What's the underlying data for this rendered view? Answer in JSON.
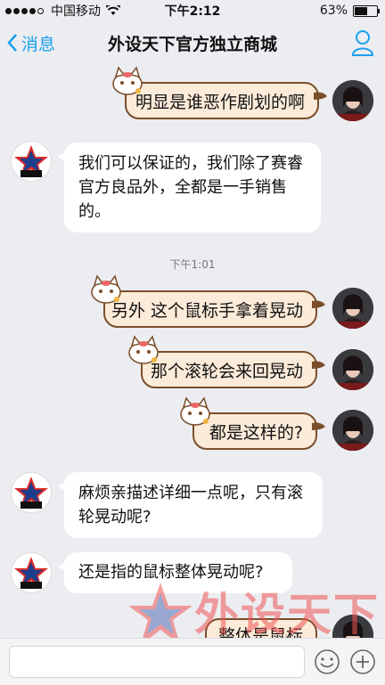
{
  "status": {
    "carrier": "中国移动",
    "time": "下午2:12",
    "battery": "63%",
    "battery_level": 0.63
  },
  "nav": {
    "back_label": "消息",
    "title": "外设天下官方独立商城"
  },
  "messages": [
    {
      "from": "user",
      "text": "明显是谁恶作剧划的啊"
    },
    {
      "from": "shop",
      "text": "我们可以保证的，我们除了赛睿官方良品外，全都是一手销售的。"
    },
    {
      "from": "user",
      "text": "另外 这个鼠标手拿着晃动"
    },
    {
      "from": "user",
      "text": "那个滚轮会来回晃动"
    },
    {
      "from": "user",
      "text": "都是这样的?"
    },
    {
      "from": "shop",
      "text": "麻烦亲描述详细一点呢，只有滚轮晃动呢?"
    },
    {
      "from": "shop",
      "text": "还是指的鼠标整体晃动呢?"
    },
    {
      "from": "user",
      "text": "整体是鼠标"
    }
  ],
  "timestamp": "下午1:01",
  "watermark": {
    "text": "外设天下",
    "url": "www.wstx.com"
  },
  "colors": {
    "accent": "#19a0ec",
    "cat_bubble": "#fcebd9",
    "cat_border": "#7a4e2a"
  },
  "icons": {
    "back": "chevron-left-icon",
    "profile": "person-icon",
    "emoji": "smiley-icon",
    "add": "plus-circle-icon"
  }
}
